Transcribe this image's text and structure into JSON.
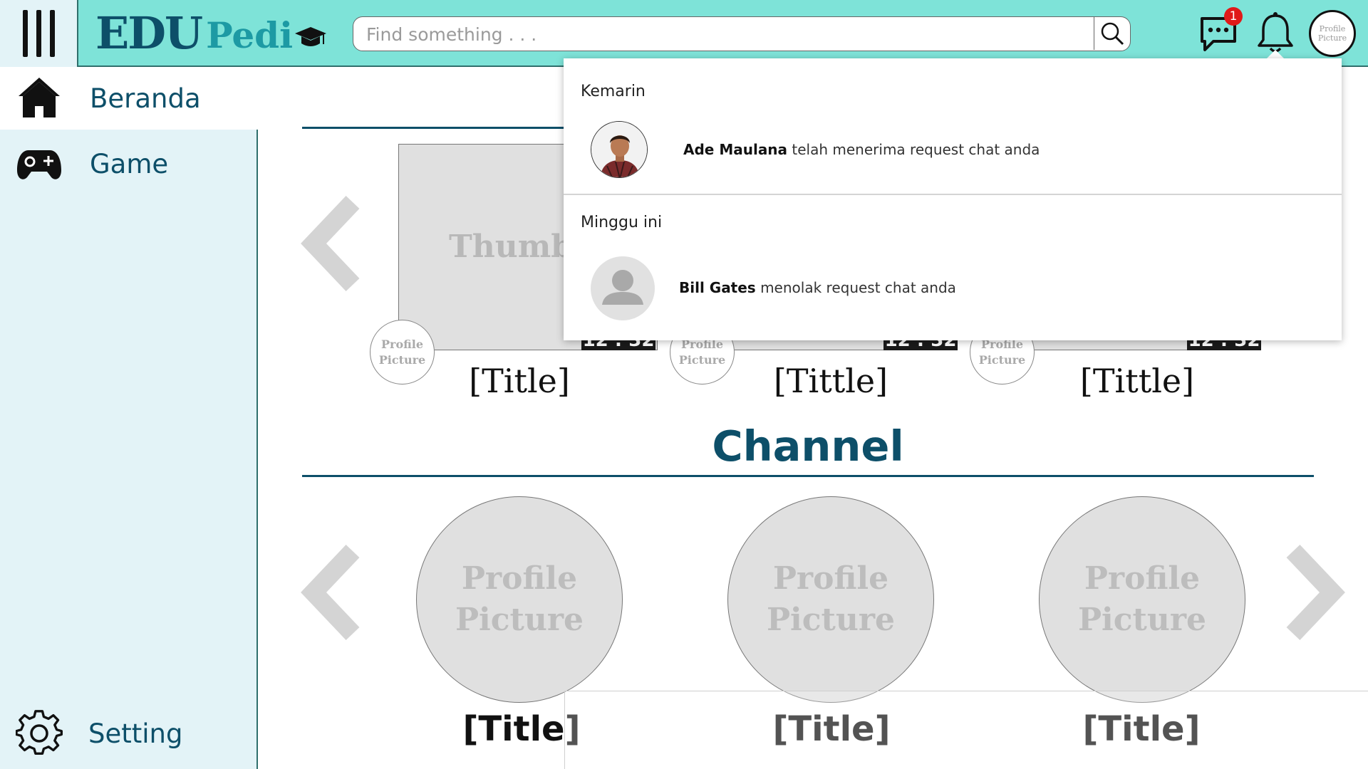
{
  "header": {
    "logo_edu": "EDU",
    "logo_pedia": "Pedi",
    "search_placeholder": "Find something . . .",
    "chat_badge_count": "1",
    "avatar_line1": "Profile",
    "avatar_line2": "Picture"
  },
  "sidebar": {
    "items": [
      {
        "label": "Beranda",
        "icon": "home-icon",
        "active": true
      },
      {
        "label": "Game",
        "icon": "gamepad-icon",
        "active": false
      }
    ],
    "setting_label": "Setting"
  },
  "videos": {
    "thumbnail_label": "Thumbnail",
    "items": [
      {
        "title": "[Title]",
        "duration": "12 : 32",
        "pp_line1": "Profile",
        "pp_line2": "Picture"
      },
      {
        "title": "[Tittle]",
        "duration": "12 : 32",
        "pp_line1": "Profile",
        "pp_line2": "Picture"
      },
      {
        "title": "[Tittle]",
        "duration": "12 : 32",
        "pp_line1": "Profile",
        "pp_line2": "Picture"
      }
    ]
  },
  "channel": {
    "heading": "Channel",
    "items": [
      {
        "title": "[Title]",
        "pp_line1": "Profile",
        "pp_line2": "Picture"
      },
      {
        "title": "[Title]",
        "pp_line1": "Profile",
        "pp_line2": "Picture"
      },
      {
        "title": "[Title]",
        "pp_line1": "Profile",
        "pp_line2": "Picture"
      }
    ]
  },
  "notifications": {
    "groups": [
      {
        "label": "Kemarin",
        "items": [
          {
            "name": "Ade Maulana",
            "message": "telah menerima request chat anda",
            "avatar": "photo"
          }
        ]
      },
      {
        "label": "Minggu ini",
        "items": [
          {
            "name": "Bill Gates",
            "message": "menolak request chat anda",
            "avatar": "placeholder-person-icon"
          }
        ]
      }
    ]
  },
  "colors": {
    "header_bg": "#7ee3d8",
    "sidebar_bg": "#e3f3f7",
    "brand_dark": "#0d4f69",
    "brand_teal": "#1d9aa4",
    "badge_red": "#e01919",
    "placeholder_gray": "#e0e0e0"
  }
}
